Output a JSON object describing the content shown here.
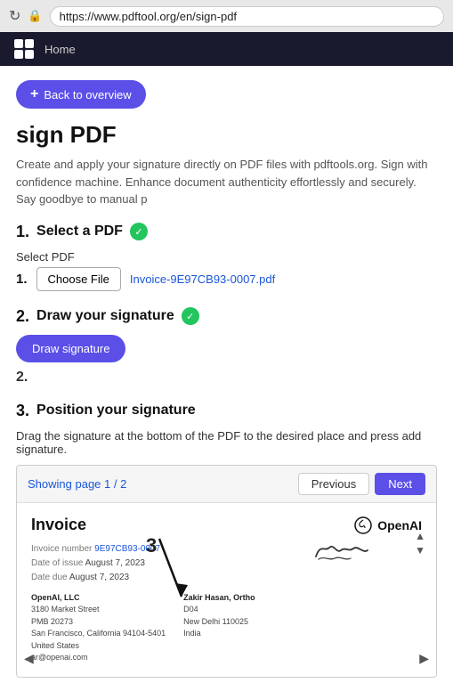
{
  "browser": {
    "url": "https://www.pdftool.org/en/sign-pdf",
    "reload_icon": "↻",
    "lock_icon": "🔒"
  },
  "nav": {
    "home_label": "Home",
    "logo_text": "X"
  },
  "back_button": {
    "label": "Back to overview",
    "icon": "+"
  },
  "page": {
    "title": "sign PDF",
    "description": "Create and apply your signature directly on PDF files with pdftools.org. Sign with confidence machine. Enhance document authenticity effortlessly and securely. Say goodbye to manual p"
  },
  "step1": {
    "header_number": "1.",
    "header_title": "Select a PDF",
    "select_pdf_label": "Select PDF",
    "step_num_inline": "1.",
    "choose_file_label": "Choose File",
    "filename": "Invoice-9E97CB93-0007.pdf"
  },
  "step2": {
    "header_number": "2.",
    "header_title": "Draw your signature",
    "step_num_inline": "2.",
    "draw_button_label": "Draw signature"
  },
  "step3": {
    "header_number": "3.",
    "header_title": "Position your signature",
    "drag_instruction": "Drag the signature at the bottom of the PDF to the desired place and press add signature."
  },
  "pdf_viewer": {
    "page_info_prefix": "Showing page",
    "current_page": "1",
    "total_pages": "2",
    "previous_label": "Previous",
    "next_label": "Next"
  },
  "invoice": {
    "title": "Invoice",
    "number_label": "Invoice number",
    "number_value": "9E97CB93-0007",
    "date_label": "Date of issue",
    "date_value": "August 7, 2023",
    "due_label": "Date due",
    "due_value": "August 7, 2023",
    "logo_text": "OpenAI",
    "bill_from_heading": "OpenAI, LLC",
    "bill_from_address": "3180 Market Street\nPMB 20273\nSan Francisco, California 94104-5401\nUnited States\nar@openai.com",
    "bill_to_heading": "Zakir Hasan, Ortho",
    "bill_to_address": "D04\nNew Delhi 110025\nIndia"
  },
  "colors": {
    "primary": "#5b4fe8",
    "success": "#22c55e",
    "link": "#1a56db"
  }
}
